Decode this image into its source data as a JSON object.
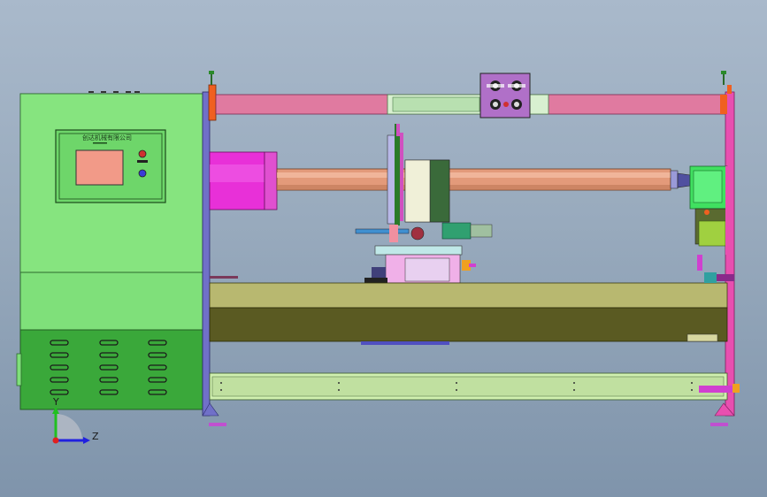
{
  "panel": {
    "label": "创达机械有限公司"
  },
  "axes": {
    "y_label": "Y",
    "z_label": "Z"
  },
  "colors": {
    "background": "#98aabd",
    "cabinet": "#7fe07a",
    "rail": "#e07aa0",
    "beam": "#e39a7a",
    "motor": "#e830d8",
    "base": "#5a5a22",
    "frame_side": "#e84fb0"
  }
}
